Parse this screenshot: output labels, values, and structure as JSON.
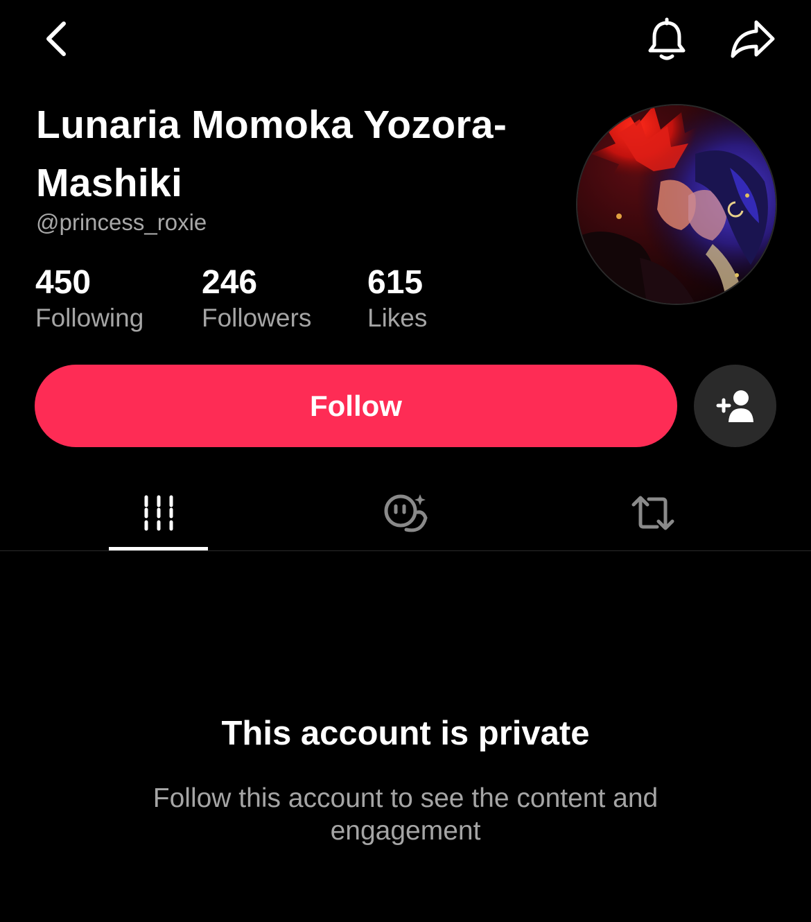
{
  "nav": {
    "back_icon": "chevron-left-icon",
    "bell_icon": "bell-icon",
    "share_icon": "share-arrow-icon"
  },
  "profile": {
    "display_name": "Lunaria Momoka Yozora-Mashiki",
    "username": "@princess_roxie",
    "stats": {
      "following": {
        "value": "450",
        "label": "Following"
      },
      "followers": {
        "value": "246",
        "label": "Followers"
      },
      "likes": {
        "value": "615",
        "label": "Likes"
      }
    }
  },
  "actions": {
    "follow_label": "Follow",
    "follow_color": "#fe2c55",
    "add_friend_icon": "add-person-icon"
  },
  "tabs": [
    {
      "name": "videos",
      "icon": "videos-grid-icon",
      "selected": true
    },
    {
      "name": "favorites",
      "icon": "favorites-face-icon",
      "selected": false
    },
    {
      "name": "reposts",
      "icon": "repost-icon",
      "selected": false
    }
  ],
  "private_notice": {
    "title": "This account is private",
    "description": "Follow this account to see the content and engagement"
  }
}
